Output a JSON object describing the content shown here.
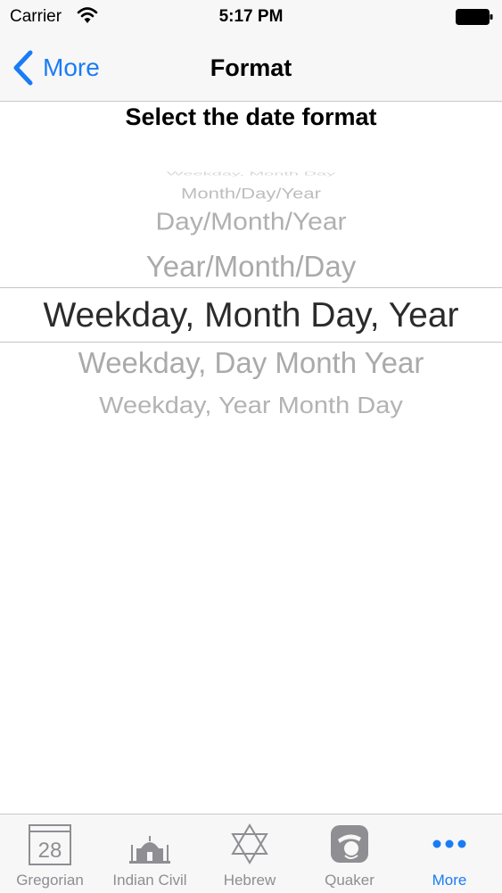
{
  "status": {
    "carrier": "Carrier",
    "time": "5:17 PM"
  },
  "nav": {
    "back_label": "More",
    "title": "Format"
  },
  "subtitle": "Select the date format",
  "picker": {
    "options": [
      "Weekday, Month Day",
      "Month/Day/Year",
      "Day/Month/Year",
      "Year/Month/Day",
      "Weekday, Month Day, Year",
      "Weekday, Day Month Year",
      "Weekday, Year Month Day"
    ],
    "selected_index": 4
  },
  "tabs": [
    {
      "label": "Gregorian",
      "icon": "calendar-icon",
      "icon_text": "28"
    },
    {
      "label": "Indian Civil",
      "icon": "taj-mahal-icon"
    },
    {
      "label": "Hebrew",
      "icon": "star-of-david-icon"
    },
    {
      "label": "Quaker",
      "icon": "quaker-icon"
    },
    {
      "label": "More",
      "icon": "more-dots-icon"
    }
  ],
  "colors": {
    "accent": "#1a7cf5",
    "inactive_tab": "#8e8e93",
    "bar_bg": "#f7f7f7"
  }
}
